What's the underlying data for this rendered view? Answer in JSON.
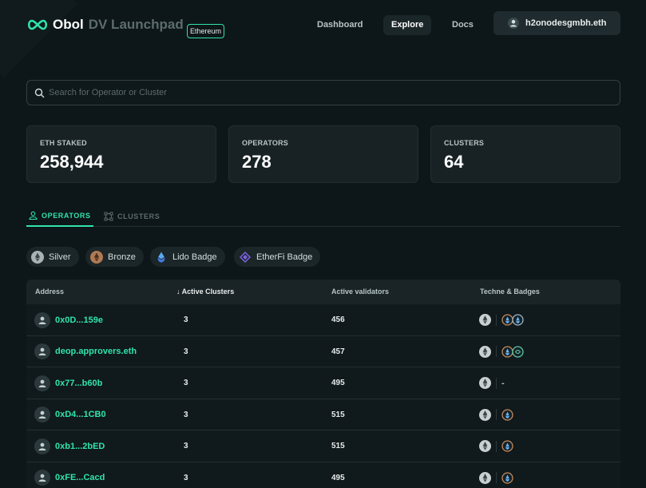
{
  "header": {
    "brand": "Obol",
    "product": "DV Launchpad",
    "network": "Ethereum",
    "nav": [
      {
        "label": "Dashboard",
        "active": false
      },
      {
        "label": "Explore",
        "active": true
      },
      {
        "label": "Docs",
        "active": false
      }
    ],
    "wallet": "h2onodesgmbh.eth"
  },
  "search": {
    "placeholder": "Search for Operator or Cluster",
    "value": ""
  },
  "stats": [
    {
      "label": "ETH STAKED",
      "value": "258,944"
    },
    {
      "label": "OPERATORS",
      "value": "278"
    },
    {
      "label": "CLUSTERS",
      "value": "64"
    }
  ],
  "tabs": [
    {
      "label": "OPERATORS",
      "active": true,
      "icon": "user-icon"
    },
    {
      "label": "CLUSTERS",
      "active": false,
      "icon": "cluster-icon"
    }
  ],
  "filters": [
    {
      "label": "Silver",
      "icon": "silver-badge-icon"
    },
    {
      "label": "Bronze",
      "icon": "bronze-badge-icon"
    },
    {
      "label": "Lido Badge",
      "icon": "lido-icon"
    },
    {
      "label": "EtherFi Badge",
      "icon": "etherfi-icon"
    }
  ],
  "table": {
    "columns": [
      "Address",
      "↓ Active Clusters",
      "Active validators",
      "Techne & Badges"
    ],
    "rows": [
      {
        "address": "0x0D...159e",
        "clusters": "3",
        "validators": "456",
        "badges": [
          "eth",
          "lido",
          "eth-blue"
        ]
      },
      {
        "address": "deop.approvers.eth",
        "clusters": "3",
        "validators": "457",
        "badges": [
          "eth",
          "lido",
          "etherfi"
        ]
      },
      {
        "address": "0x77...b60b",
        "clusters": "3",
        "validators": "495",
        "badges": [
          "eth"
        ],
        "badge_text": "-"
      },
      {
        "address": "0xD4...1CB0",
        "clusters": "3",
        "validators": "515",
        "badges": [
          "eth",
          "lido"
        ]
      },
      {
        "address": "0xb1...2bED",
        "clusters": "3",
        "validators": "515",
        "badges": [
          "eth",
          "lido"
        ]
      },
      {
        "address": "0xFE...Cacd",
        "clusters": "3",
        "validators": "495",
        "badges": [
          "eth",
          "lido"
        ]
      }
    ]
  },
  "colors": {
    "accent": "#2fe4ab",
    "background": "#0d1618",
    "card": "#182225"
  }
}
